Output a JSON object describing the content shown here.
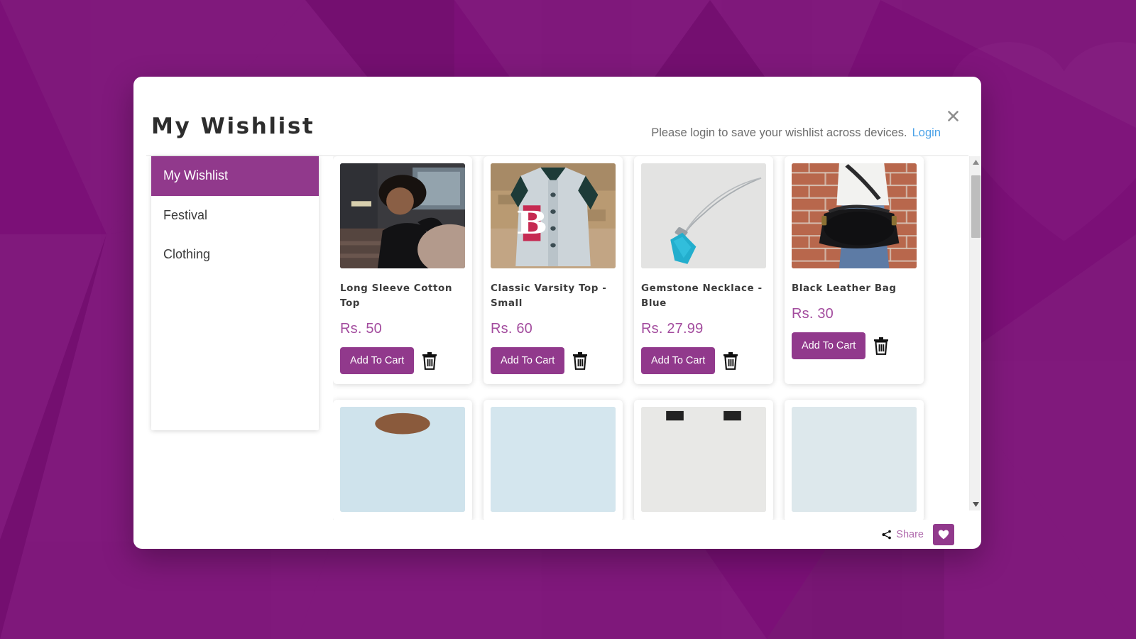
{
  "page": {
    "background_color": "#7b1077",
    "accent_color": "#91398c",
    "price_color": "#a34c9e",
    "link_color": "#4da3e8"
  },
  "modal": {
    "title": "My Wishlist",
    "login_note": "Please login to save your wishlist across devices.",
    "login_label": "Login",
    "close_label": "✕"
  },
  "sidebar": {
    "items": [
      {
        "label": "My Wishlist",
        "active": true
      },
      {
        "label": "Festival",
        "active": false
      },
      {
        "label": "Clothing",
        "active": false
      }
    ]
  },
  "products": [
    {
      "title": "Long Sleeve Cotton Top",
      "price": "Rs. 50",
      "add_to_cart": "Add To Cart",
      "image_alt": "woman-in-black-long-sleeve-top"
    },
    {
      "title": "Classic Varsity Top - Small",
      "price": "Rs. 60",
      "add_to_cart": "Add To Cart",
      "image_alt": "grey-varsity-jacket-with-red-letter"
    },
    {
      "title": "Gemstone Necklace - Blue",
      "price": "Rs. 27.99",
      "add_to_cart": "Add To Cart",
      "image_alt": "blue-gemstone-pendant-necklace"
    },
    {
      "title": "Black Leather Bag",
      "price": "Rs. 30",
      "add_to_cart": "Add To Cart",
      "image_alt": "black-leather-bag-against-brick-wall"
    }
  ],
  "scrollbar": {
    "up_arrow": "▲",
    "down_arrow": "▼"
  },
  "footer": {
    "share_label": "Share",
    "heart_label": "♥"
  }
}
